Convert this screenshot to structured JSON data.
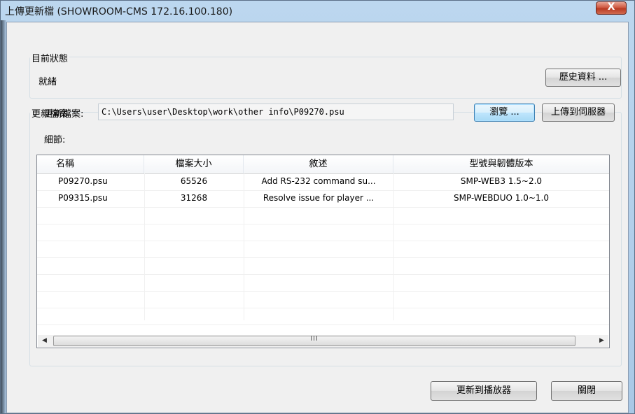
{
  "window": {
    "title": "上傳更新檔 (SHOWROOM-CMS  172.16.100.180)",
    "close_label": "X"
  },
  "status_group": {
    "legend": "目前狀態",
    "status_text": "就緒",
    "history_button": "歷史資料 ..."
  },
  "file_group": {
    "legend": "更新檔案",
    "file_label": "更新檔案:",
    "file_path": "C:\\Users\\user\\Desktop\\work\\other info\\P09270.psu",
    "browse_button": "瀏覽 ...",
    "upload_button": "上傳到伺服器",
    "details_label": "細節:",
    "columns": [
      "名稱",
      "檔案大小",
      "敘述",
      "型號與韌體版本"
    ],
    "rows": [
      [
        "P09270.psu",
        "65526",
        "Add RS-232 command su...",
        "SMP-WEB3  1.5~2.0"
      ],
      [
        "P09315.psu",
        "31268",
        "Resolve issue for player ...",
        "SMP-WEBDUO  1.0~1.0"
      ]
    ],
    "scroll_left": "◀",
    "scroll_right": "▶",
    "scroll_grip": "III"
  },
  "footer": {
    "update_player_button": "更新到播放器",
    "close_button": "關閉"
  }
}
